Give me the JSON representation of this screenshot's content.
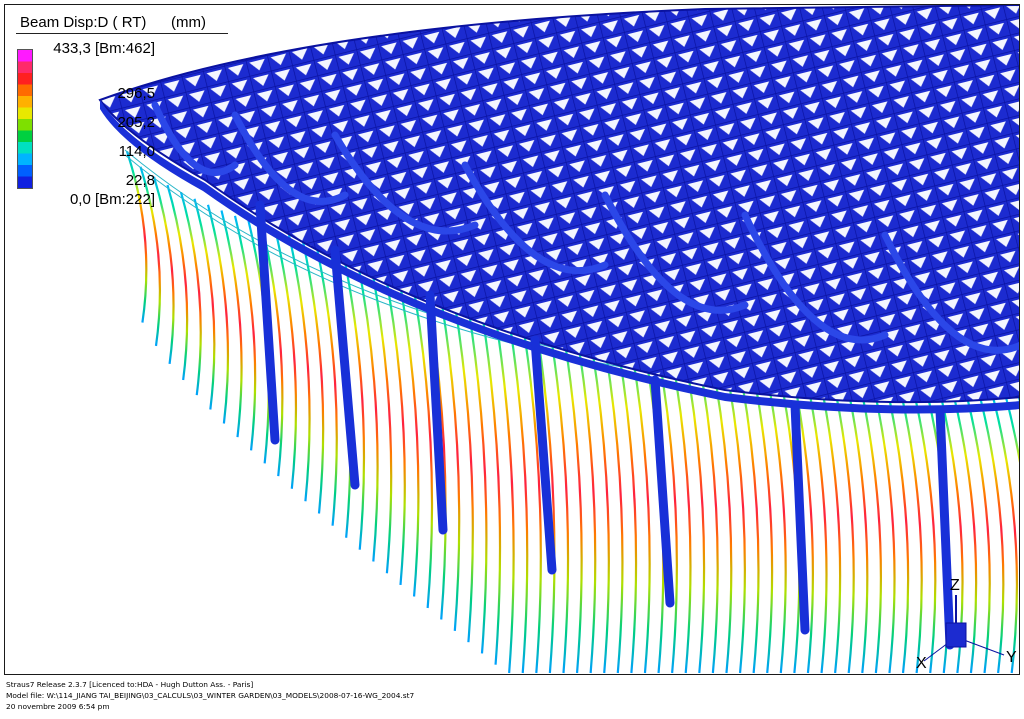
{
  "legend": {
    "title": "Beam Disp:D ( RT)",
    "units": "(mm)",
    "max_label": "433,3 [Bm:462]",
    "ticks": [
      "296,5",
      "205,2",
      "114,0",
      "22,8"
    ],
    "min_label": "0,0 [Bm:222]",
    "colors": [
      "#ff1aff",
      "#ff2a6a",
      "#ff2020",
      "#ff6a00",
      "#ffb000",
      "#e8e800",
      "#7ee000",
      "#00d040",
      "#00e0c0",
      "#00b4ff",
      "#0060ff",
      "#1020e0"
    ]
  },
  "axes": {
    "z": "Z",
    "x": "X",
    "y": "Y"
  },
  "footer": {
    "line1": "Straus7 Release 2.3.7 [Licenced to:HDA - Hugh Dutton Ass. - Paris]",
    "line2": "Model file: W:\\114_JIANG TAI_BEIJING\\03_CALCULS\\03_WINTER GARDEN\\03_MODELS\\2008-07-16-WG_2004.st7",
    "line3": "20 novembre 2009    6:54 pm"
  }
}
